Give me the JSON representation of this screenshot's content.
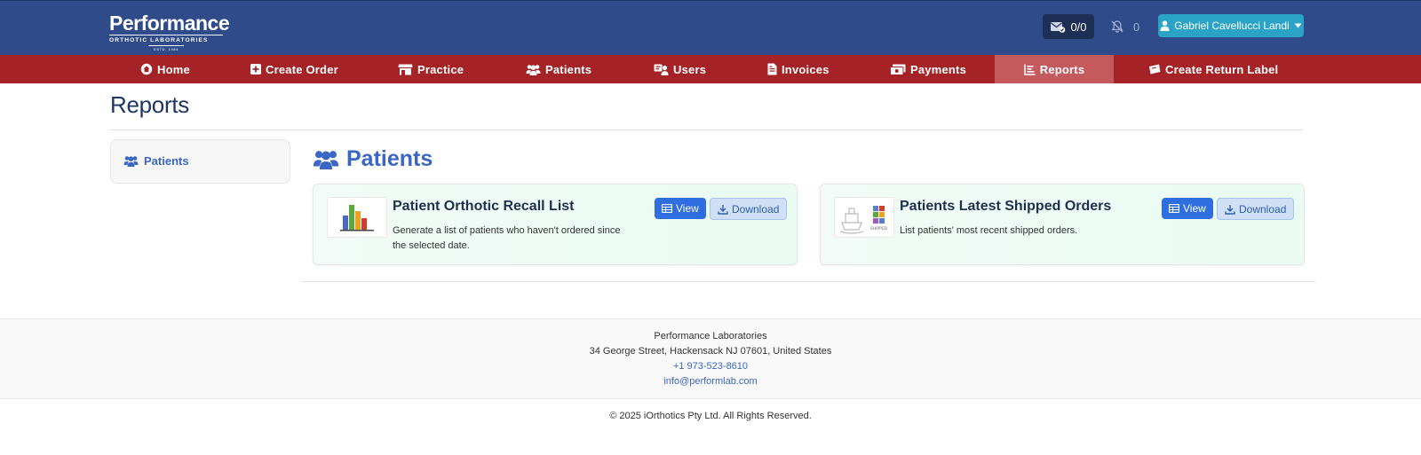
{
  "header": {
    "logo_main": "Performance",
    "logo_sub": "ORTHOTIC LABORATORIES",
    "logo_est": "ESTD. 1984",
    "messages_count": "0/0",
    "notifications_count": "0",
    "user_name": "Gabriel Cavellucci Landi"
  },
  "nav": {
    "items": [
      {
        "label": "Home",
        "icon": "home-icon"
      },
      {
        "label": "Create Order",
        "icon": "plus-square-icon"
      },
      {
        "label": "Practice",
        "icon": "store-icon"
      },
      {
        "label": "Patients",
        "icon": "users-icon"
      },
      {
        "label": "Users",
        "icon": "user-group-icon"
      },
      {
        "label": "Invoices",
        "icon": "file-invoice-icon"
      },
      {
        "label": "Payments",
        "icon": "money-icon"
      },
      {
        "label": "Reports",
        "icon": "list-icon"
      },
      {
        "label": "Create Return Label",
        "icon": "ticket-icon"
      }
    ],
    "active": "Reports"
  },
  "page": {
    "title": "Reports"
  },
  "sidebar": {
    "items": [
      {
        "label": "Patients",
        "icon": "users-icon"
      }
    ]
  },
  "section": {
    "title": "Patients",
    "reports": [
      {
        "title": "Patient Orthotic Recall List",
        "description": "Generate a list of patients who haven't ordered since the selected date.",
        "view_label": "View",
        "download_label": "Download",
        "thumb": "bar-chart-icon"
      },
      {
        "title": "Patients Latest Shipped Orders",
        "description": "List patients' most recent shipped orders.",
        "view_label": "View",
        "download_label": "Download",
        "thumb": "shipped-boxes-icon",
        "thumb_text": "SHIPPED"
      }
    ]
  },
  "footer": {
    "company": "Performance Laboratories",
    "address": "34 George Street, Hackensack NJ 07601, United States",
    "phone": "+1 973-523-8610",
    "email": "info@performlab.com",
    "copyright": "© 2025 iOrthotics Pty Ltd. All Rights Reserved."
  },
  "colors": {
    "header_bg": "#2f4b8a",
    "nav_bg": "#a52227",
    "nav_active_bg": "#c55a5e",
    "accent_blue": "#3a66c4",
    "user_button_bg": "#2aa3c6"
  }
}
